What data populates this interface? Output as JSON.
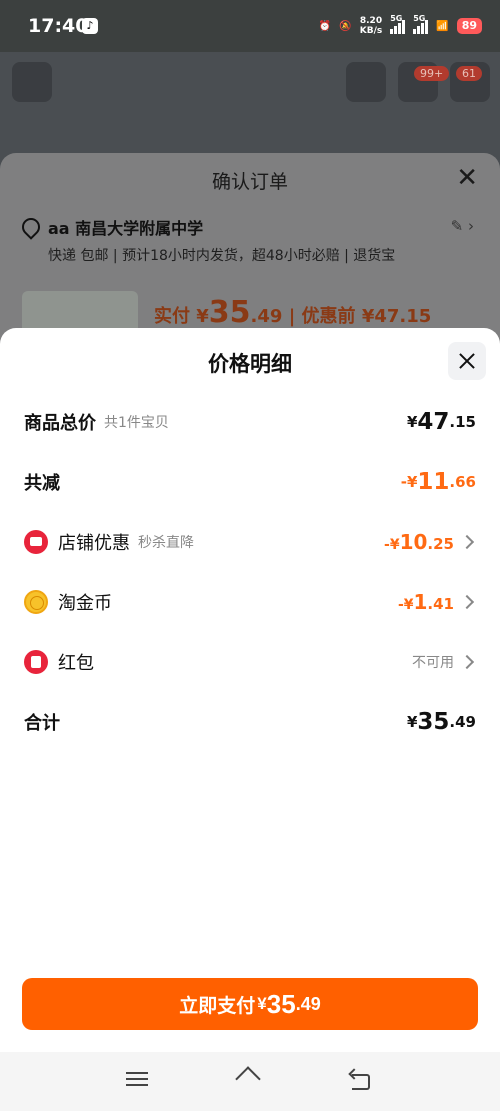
{
  "status_bar": {
    "time": "17:40",
    "net_speed_value": "8.20",
    "net_speed_unit": "KB/s",
    "signal1_label": "5G",
    "signal2_label": "5G",
    "battery": "89"
  },
  "background_page": {
    "cart_badge": "99+",
    "msg_badge": "61"
  },
  "order": {
    "title": "确认订单",
    "address_name": "aa 南昌大学附属中学",
    "address_sub": "快递 包邮 | 预计18小时内发货，超48小时必赔 | 退货宝",
    "price_prefix": "实付 ¥",
    "price_int": "35",
    "price_dec": ".49",
    "price_before": "| 优惠前 ¥47.15"
  },
  "price_detail": {
    "title": "价格明细",
    "total": {
      "label": "商品总价",
      "sub": "共1件宝贝",
      "currency": "¥",
      "int": "47",
      "dec": ".15"
    },
    "reduction": {
      "label": "共减",
      "currency": "-¥",
      "int": "11",
      "dec": ".66"
    },
    "shop_discount": {
      "label": "店铺优惠",
      "sub": "秒杀直降",
      "currency": "-¥",
      "int": "10",
      "dec": ".25"
    },
    "gold_coin": {
      "label": "淘金币",
      "currency": "-¥",
      "int": "1",
      "dec": ".41"
    },
    "red_packet": {
      "label": "红包",
      "value": "不可用"
    },
    "subtotal": {
      "label": "合计",
      "currency": "¥",
      "int": "35",
      "dec": ".49"
    }
  },
  "pay_button": {
    "label": "立即支付",
    "currency": "¥",
    "int": "35",
    "dec": ".49"
  },
  "colors": {
    "accent": "#ff6000",
    "discount": "#ff6a13",
    "store_icon": "#e8243b",
    "coin_icon": "#f7c22a"
  }
}
